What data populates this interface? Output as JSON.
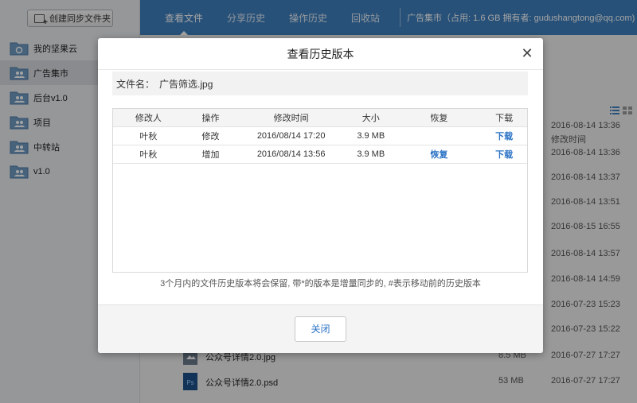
{
  "sidebar": {
    "create_button": "创建同步文件夹",
    "items": [
      {
        "label": "我的坚果云",
        "icon": "cloud-folder-icon"
      },
      {
        "label": "广告集市",
        "icon": "shared-folder-icon",
        "active": true
      },
      {
        "label": "后台v1.0",
        "icon": "shared-folder-icon"
      },
      {
        "label": "项目",
        "icon": "shared-folder-icon"
      },
      {
        "label": "中转站",
        "icon": "shared-folder-icon"
      },
      {
        "label": "v1.0",
        "icon": "shared-folder-icon"
      }
    ]
  },
  "topbar": {
    "tabs": [
      "查看文件",
      "分享历史",
      "操作历史",
      "回收站"
    ],
    "active_tab": 0,
    "info": "广告集市（占用:  1.6 GB   拥有者:  gudushangtong@qq.com)"
  },
  "file_list": {
    "date_header": "修改时间",
    "dates": [
      "2016-08-14 13:36",
      "2016-08-14 13:36",
      "2016-08-14 13:37",
      "2016-08-14 13:51",
      "2016-08-15 16:55",
      "2016-08-14 13:57",
      "2016-08-14 14:59",
      "2016-07-23 15:23",
      "2016-07-23 15:22"
    ],
    "files": [
      {
        "name": "公众号详情2.0.jpg",
        "size": "8.5 MB",
        "date": "2016-07-27 17:27"
      },
      {
        "name": "公众号详情2.0.psd",
        "size": "53 MB",
        "date": "2016-07-27 17:27"
      }
    ]
  },
  "modal": {
    "title": "查看历史版本",
    "close_glyph": "✕",
    "file_label": "文件名：",
    "file_name": "广告筛选.jpg",
    "columns": [
      "修改人",
      "操作",
      "修改时间",
      "大小",
      "恢复",
      "下载"
    ],
    "rows": [
      {
        "user": "叶秋",
        "action": "修改",
        "time": "2016/08/14 17:20",
        "size": "3.9 MB",
        "restore": "",
        "download": "下载"
      },
      {
        "user": "叶秋",
        "action": "增加",
        "time": "2016/08/14 13:56",
        "size": "3.9 MB",
        "restore": "恢复",
        "download": "下载"
      }
    ],
    "note": "3个月内的文件历史版本将会保留, 带*的版本是增量同步的, #表示移动前的历史版本",
    "close_button": "关闭"
  },
  "colors": {
    "topbar": "#3d7fbd",
    "link": "#2a73c5",
    "sidebar": "#e9ecef"
  }
}
